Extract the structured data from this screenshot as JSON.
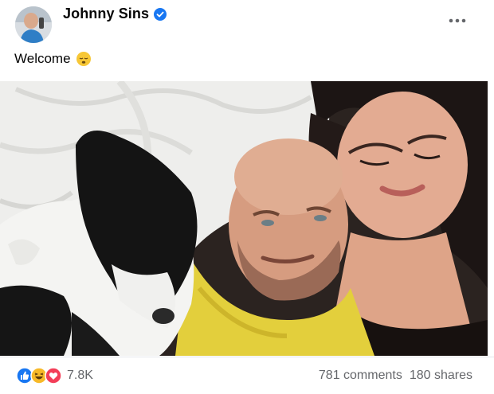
{
  "post": {
    "author": "Johnny Sins",
    "caption": "Welcome",
    "reaction_count": "7.8K",
    "comments": "781 comments",
    "shares": "180 shares"
  },
  "icons": {
    "verified": "verified-badge-icon",
    "more": "more-options-icon",
    "caption_emoji": "sleeping-face-emoji",
    "reactions": [
      "like-reaction-icon",
      "haha-reaction-icon",
      "love-reaction-icon"
    ]
  },
  "colors": {
    "verified_blue": "#1877f2",
    "like_blue": "#1877f2",
    "haha_yellow": "#f7b928",
    "love_red": "#f33e58",
    "meta_grey": "#65676b"
  }
}
